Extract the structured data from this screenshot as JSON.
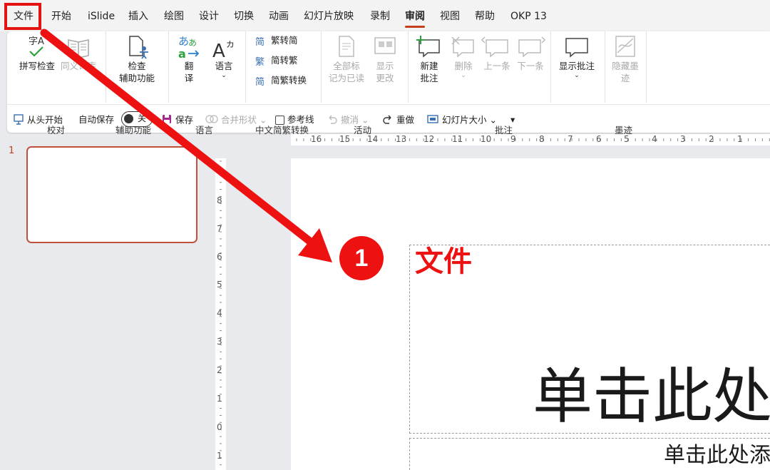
{
  "menu": {
    "tabs": [
      "文件",
      "开始",
      "iSlide",
      "插入",
      "绘图",
      "设计",
      "切换",
      "动画",
      "幻灯片放映",
      "录制",
      "审阅",
      "视图",
      "帮助",
      "OKP 13"
    ],
    "active_tab": "审阅",
    "highlighted_tab": "文件"
  },
  "ribbon": {
    "groups": {
      "proofing": "校对",
      "accessibility": "辅助功能",
      "language": "语言",
      "chinese_conversion": "中文简繁转换",
      "activity": "活动",
      "comments": "批注",
      "ink": "墨迹"
    },
    "buttons": {
      "spell_check": "拼写检查",
      "thesaurus": "同义词库",
      "check_access_1": "检查",
      "check_access_2": "辅助功能",
      "translate_1": "翻",
      "translate_2": "译",
      "language": "语言",
      "trad_to_simp": "繁转简",
      "simp_to_trad": "简转繁",
      "conversion": "简繁转换",
      "mark_all_read_1": "全部标",
      "mark_all_read_2": "记为已读",
      "show_changes_1": "显示",
      "show_changes_2": "更改",
      "new_comment_1": "新建",
      "new_comment_2": "批注",
      "delete": "删除",
      "previous": "上一条",
      "next": "下一条",
      "show_comments": "显示批注",
      "hide_ink_1": "隐藏墨",
      "hide_ink_2": "迹"
    }
  },
  "qat": {
    "from_start": "从头开始",
    "autosave": "自动保存",
    "autosave_state": "关",
    "save": "保存",
    "merge_shapes": "合并形状",
    "guides": "参考线",
    "undo": "撤消",
    "redo": "重做",
    "slide_size": "幻灯片大小"
  },
  "slides": {
    "number": "1"
  },
  "ruler": {
    "h_numbers": [
      "16",
      "15",
      "14",
      "13",
      "12",
      "11",
      "10",
      "9",
      "8",
      "7",
      "6",
      "5",
      "4",
      "3",
      "2",
      "1"
    ],
    "v_numbers": [
      "8",
      "7",
      "6",
      "5",
      "4",
      "3",
      "2",
      "1",
      "0",
      "1"
    ]
  },
  "canvas": {
    "title_placeholder": "单击此处",
    "subtitle_placeholder": "单击此处添"
  },
  "annotation": {
    "step": "1",
    "label": "文件"
  },
  "colors": {
    "accent": "#c43e1c",
    "annotation_red": "#ee1111",
    "icon_green": "#2aa23d",
    "icon_blue": "#3a6fb4"
  }
}
